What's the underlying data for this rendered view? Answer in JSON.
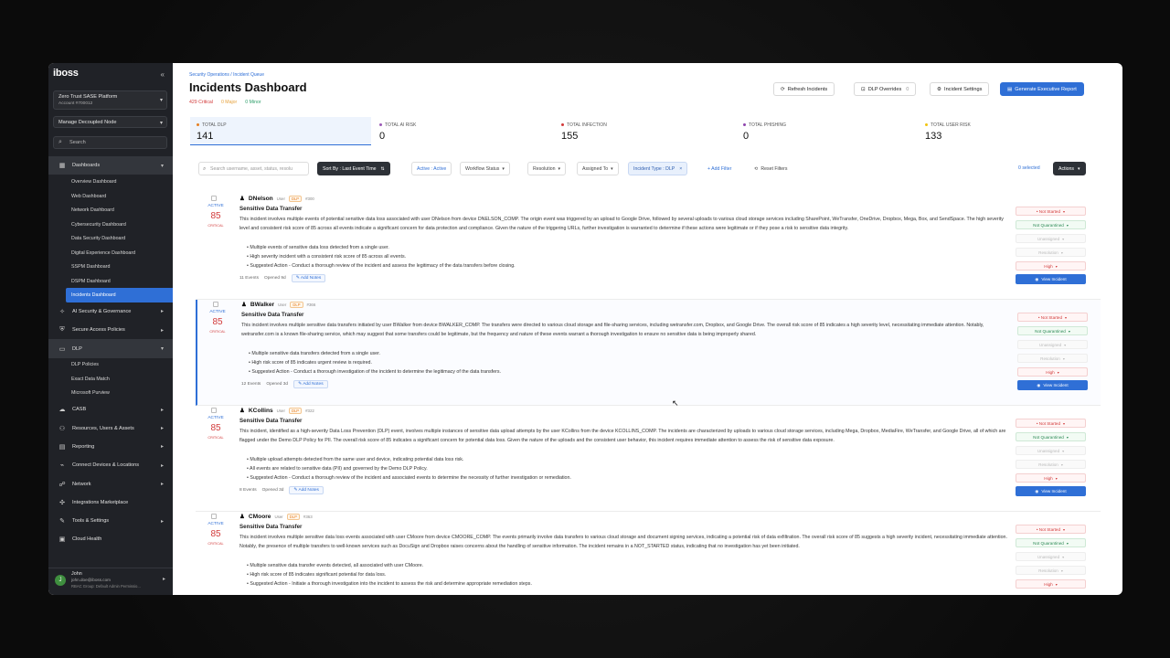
{
  "brand": "iboss",
  "platform": {
    "name": "Zero Trust SASE Platform",
    "account": "Account #700012"
  },
  "node": "Manage Decoupled Node",
  "sidebar_search": "Search",
  "nav": {
    "dashboards": "Dashboards",
    "dash_items": [
      "Overview Dashboard",
      "Web Dashboard",
      "Network Dashboard",
      "Cybersecurity Dashboard",
      "Data Security Dashboard",
      "Digital Experience Dashboard",
      "SSPM Dashboard",
      "DSPM Dashboard",
      "Incidents Dashboard"
    ],
    "ai": "AI Security & Governance",
    "sap": "Secure Access Policies",
    "dlp": "DLP",
    "dlp_items": [
      "DLP Policies",
      "Exact Data Match",
      "Microsoft Purview"
    ],
    "casb": "CASB",
    "rua": "Resources, Users & Assets",
    "reporting": "Reporting",
    "cdl": "Connect Devices & Locations",
    "network": "Network",
    "integrations": "Integrations Marketplace",
    "tools": "Tools & Settings",
    "health": "Cloud Health"
  },
  "user": {
    "name": "John",
    "email": "john.doe@iboss.com",
    "group": "RBAC Group: Default Admin Permissio..."
  },
  "header": {
    "breadcrumb": "Security Operations / Incident Queue",
    "title": "Incidents Dashboard",
    "critical": "429 Critical",
    "major": "0 Major",
    "minor": "0 Minor",
    "refresh": "Refresh Incidents",
    "overrides": "DLP Overrides",
    "overrides_count": "0",
    "settings": "Incident Settings",
    "report": "Generate Executive Report"
  },
  "stats": [
    {
      "label": "TOTAL DLP",
      "value": "141",
      "color": "#e67e22"
    },
    {
      "label": "TOTAL AI RISK",
      "value": "0",
      "color": "#9b59b6"
    },
    {
      "label": "TOTAL INFECTION",
      "value": "155",
      "color": "#d23a3a"
    },
    {
      "label": "TOTAL PHISHING",
      "value": "0",
      "color": "#8e44ad"
    },
    {
      "label": "TOTAL USER RISK",
      "value": "133",
      "color": "#f1c40f"
    }
  ],
  "filters": {
    "search_placeholder": "Search username, asset, status, resolu",
    "sort": "Sort By : Last Event Time",
    "active": "Active : Active",
    "workflow": "Workflow Status",
    "resolution": "Resolution",
    "assigned": "Assigned To",
    "incident_type": "Incident Type : DLP",
    "add_filter": "+ Add Filter",
    "reset": "Reset Filters",
    "selected": "0 selected",
    "actions": "Actions"
  },
  "common": {
    "status": "ACTIVE",
    "critical": "CRITICAL",
    "user_tag": "User",
    "dlp_tag": "DLP",
    "add_notes": "Add Notes",
    "not_started": "• Not Started",
    "not_quarantined": "Not Quarantined",
    "unassigned": "Unassigned",
    "resolution": "Resolution",
    "high": "High",
    "view": "View Incident"
  },
  "incidents": [
    {
      "user": "DNelson",
      "id": "#300",
      "score": "85",
      "title": "Sensitive Data Transfer",
      "desc": "This incident involves multiple events of potential sensitive data loss associated with user DNelson from device DNELSON_COMP. The origin event was triggered by an upload to Google Drive, followed by several uploads to various cloud storage services including SharePoint, WeTransfer, OneDrive, Dropbox, Mega, Box, and SendSpace. The high severity level and consistent risk score of 85 across all events indicate a significant concern for data protection and compliance. Given the nature of the triggering URLs, further investigation is warranted to determine if these actions were legitimate or if they pose a risk to sensitive data integrity.",
      "bullets": [
        "Multiple events of sensitive data loss detected from a single user.",
        "High severity incident with a consistent risk score of 85 across all events.",
        "Suggested Action - Conduct a thorough review of the incident and assess the legitimacy of the data transfers before closing."
      ],
      "events": "11 Events",
      "opened": "Opened 9d"
    },
    {
      "user": "BWalker",
      "id": "#366",
      "score": "85",
      "title": "Sensitive Data Transfer",
      "desc": "This incident involves multiple sensitive data transfers initiated by user BWalker from device BWALKER_COMP. The transfers were directed to various cloud storage and file-sharing services, including wetransfer.com, Dropbox, and Google Drive. The overall risk score of 85 indicates a high severity level, necessitating immediate attention. Notably, wetransfer.com is a known file-sharing service, which may suggest that some transfers could be legitimate, but the frequency and nature of these events warrant a thorough investigation to ensure no sensitive data is being improperly shared.",
      "bullets": [
        "Multiple sensitive data transfers detected from a single user.",
        "High risk score of 85 indicates urgent review is required.",
        "Suggested Action - Conduct a thorough investigation of the incident to determine the legitimacy of the data transfers."
      ],
      "events": "12 Events",
      "opened": "Opened 3d"
    },
    {
      "user": "KCollins",
      "id": "#322",
      "score": "85",
      "title": "Sensitive Data Transfer",
      "desc": "This incident, identified as a high-severity Data Loss Prevention (DLP) event, involves multiple instances of sensitive data upload attempts by the user KCollins from the device KCOLLINS_COMP. The incidents are characterized by uploads to various cloud storage services, including Mega, Dropbox, MediaFire, WeTransfer, and Google Drive, all of which are flagged under the Demo DLP Policy for PII. The overall risk score of 85 indicates a significant concern for potential data loss. Given the nature of the uploads and the consistent user behavior, this incident requires immediate attention to assess the risk of sensitive data exposure.",
      "bullets": [
        "Multiple upload attempts detected from the same user and device, indicating potential data loss risk.",
        "All events are related to sensitive data (PII) and governed by the Demo DLP Policy.",
        "Suggested Action - Conduct a thorough review of the incident and associated events to determine the necessity of further investigation or remediation."
      ],
      "events": "8 Events",
      "opened": "Opened 3d"
    },
    {
      "user": "CMoore",
      "id": "#363",
      "score": "85",
      "title": "Sensitive Data Transfer",
      "desc": "This incident involves multiple sensitive data loss events associated with user CMoore from device CMOORE_COMP. The events primarily involve data transfers to various cloud storage and document signing services, indicating a potential risk of data exfiltration. The overall risk score of 85 suggests a high severity incident, necessitating immediate attention. Notably, the presence of multiple transfers to well-known services such as DocuSign and Dropbox raises concerns about the handling of sensitive information. The incident remains in a NOT_STARTED status, indicating that no investigation has yet been initiated.",
      "bullets": [
        "Multiple sensitive data transfer events detected, all associated with user CMoore.",
        "High risk score of 85 indicates significant potential for data loss.",
        "Suggested Action - Initiate a thorough investigation into the incident to assess the risk and determine appropriate remediation steps."
      ],
      "events": "",
      "opened": ""
    }
  ]
}
